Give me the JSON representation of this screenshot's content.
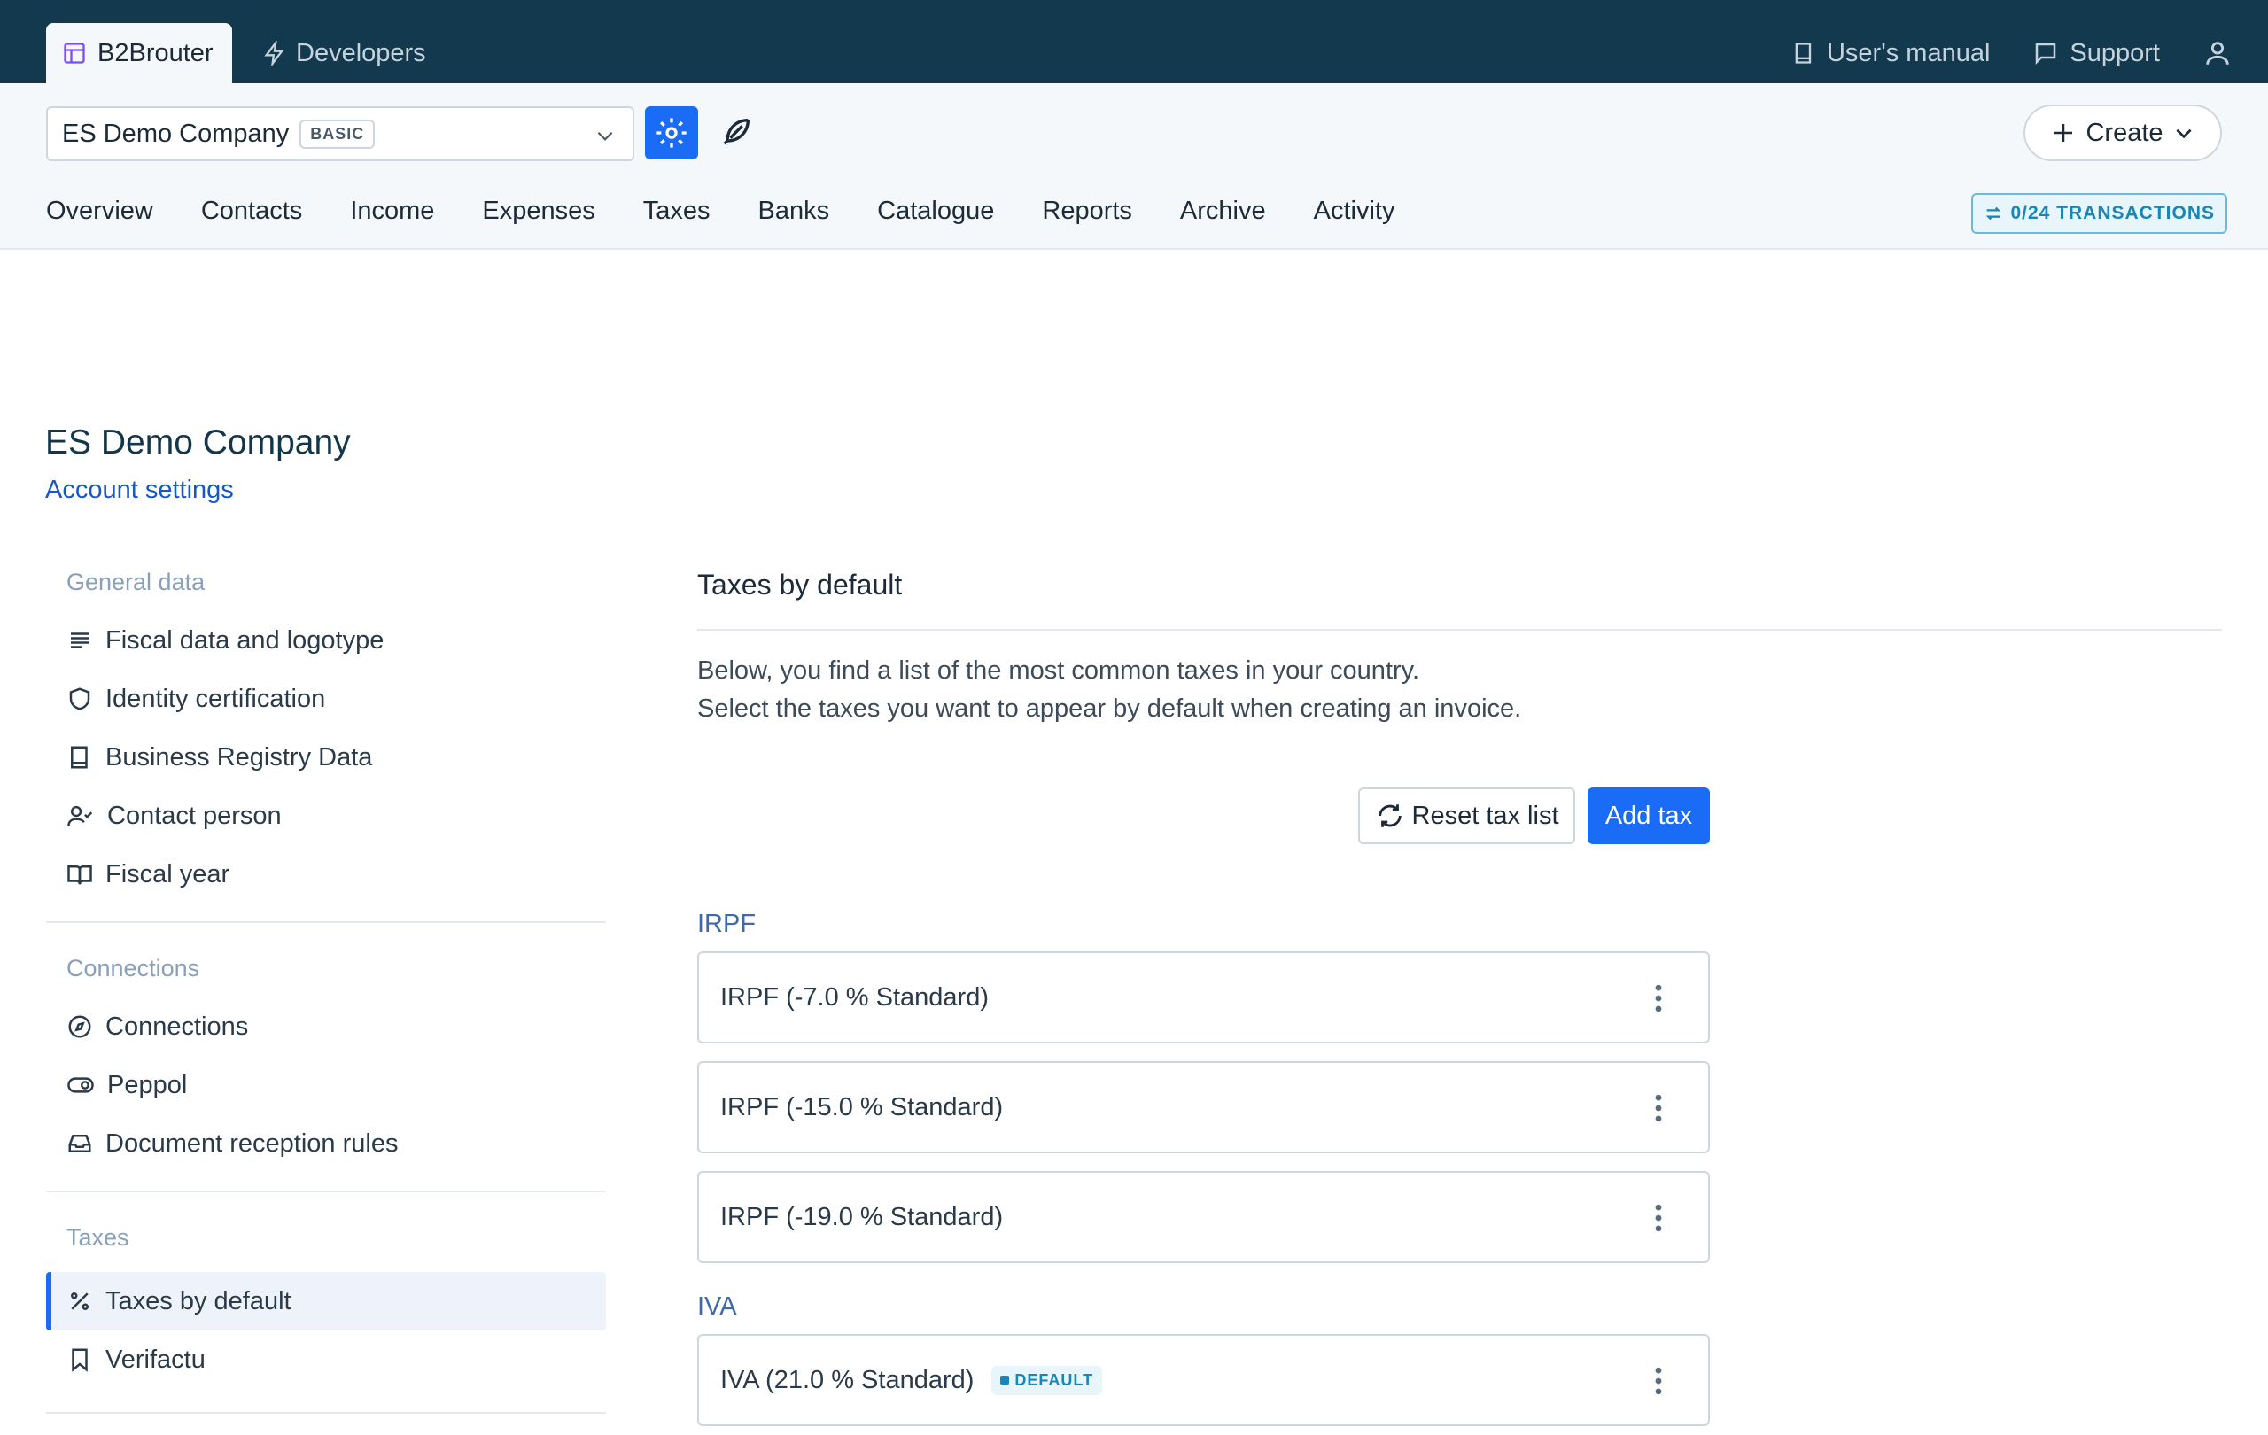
{
  "topbar": {
    "brand_tab": "B2Brouter",
    "developers_tab": "Developers",
    "users_manual": "User's manual",
    "support": "Support"
  },
  "subbar": {
    "company": "ES Demo Company",
    "plan_badge": "BASIC",
    "create_label": "Create",
    "nav": [
      "Overview",
      "Contacts",
      "Income",
      "Expenses",
      "Taxes",
      "Banks",
      "Catalogue",
      "Reports",
      "Archive",
      "Activity"
    ],
    "transactions_badge": "0/24 TRANSACTIONS"
  },
  "page": {
    "title": "ES Demo Company",
    "subtitle": "Account settings"
  },
  "sidebar": {
    "sections": [
      {
        "title": "General data",
        "items": [
          {
            "label": "Fiscal data and logotype",
            "icon": "lines-icon"
          },
          {
            "label": "Identity certification",
            "icon": "shield-icon"
          },
          {
            "label": "Business Registry Data",
            "icon": "book-icon"
          },
          {
            "label": "Contact person",
            "icon": "user-check-icon"
          },
          {
            "label": "Fiscal year",
            "icon": "open-book-icon"
          }
        ]
      },
      {
        "title": "Connections",
        "items": [
          {
            "label": "Connections",
            "icon": "compass-icon"
          },
          {
            "label": "Peppol",
            "icon": "toggle-icon"
          },
          {
            "label": "Document reception rules",
            "icon": "inbox-icon"
          }
        ]
      },
      {
        "title": "Taxes",
        "items": [
          {
            "label": "Taxes by default",
            "icon": "percent-icon",
            "active": true
          },
          {
            "label": "Verifactu",
            "icon": "bookmark-icon"
          }
        ]
      }
    ]
  },
  "main": {
    "title": "Taxes by default",
    "desc_line1": "Below, you find a list of the most common taxes in your country.",
    "desc_line2": "Select the taxes you want to appear by default when creating an invoice.",
    "reset_label": "Reset tax list",
    "add_label": "Add tax",
    "groups": [
      {
        "name": "IRPF",
        "taxes": [
          {
            "label": "IRPF (-7.0 % Standard)"
          },
          {
            "label": "IRPF (-15.0 % Standard)"
          },
          {
            "label": "IRPF (-19.0 % Standard)"
          }
        ]
      },
      {
        "name": "IVA",
        "taxes": [
          {
            "label": "IVA (21.0 % Standard)",
            "badge": "DEFAULT"
          }
        ]
      }
    ]
  },
  "colors": {
    "topbar": "#12394d",
    "primary": "#1a6bf5",
    "accent_badge": "#1a86b8"
  }
}
